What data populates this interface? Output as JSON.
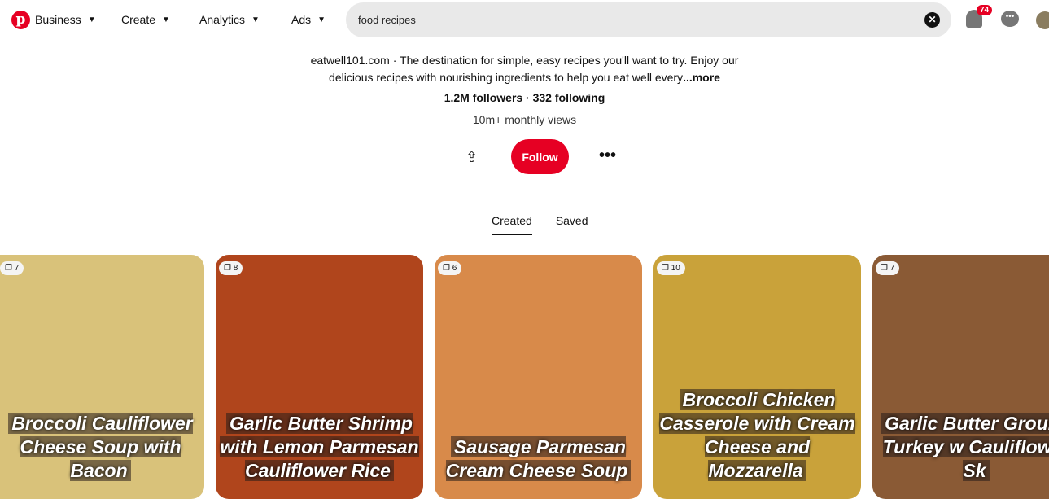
{
  "header": {
    "nav": [
      {
        "label": "Business"
      },
      {
        "label": "Create"
      },
      {
        "label": "Analytics"
      },
      {
        "label": "Ads"
      }
    ],
    "search_value": "food recipes",
    "notification_count": "74"
  },
  "profile": {
    "description": "eatwell101.com · The destination for simple, easy recipes you'll want to try. Enjoy our delicious recipes with nourishing ingredients to help you eat well every",
    "more": "...more",
    "stats": "1.2M followers · 332 following",
    "views": "10m+ monthly views",
    "follow_label": "Follow"
  },
  "tabs": [
    {
      "label": "Created",
      "active": true
    },
    {
      "label": "Saved"
    }
  ],
  "pins": [
    {
      "count": "7",
      "title": "Broccoli Cauliflower Cheese Soup with Bacon",
      "bg": "#d9c27a"
    },
    {
      "count": "8",
      "title": "Garlic Butter Shrimp with Lemon Parmesan Cauliflower Rice",
      "bg": "#b0451c"
    },
    {
      "count": "6",
      "title": "Sausage Parmesan Cream Cheese Soup",
      "bg": "#d88a4a"
    },
    {
      "count": "10",
      "title": "Broccoli Chicken Casserole with Cream Cheese and Mozzarella",
      "bg": "#c9a23a"
    },
    {
      "count": "7",
      "title": "Garlic Butter Ground Turkey w Cauliflower Sk",
      "bg": "#8a5a35"
    }
  ]
}
